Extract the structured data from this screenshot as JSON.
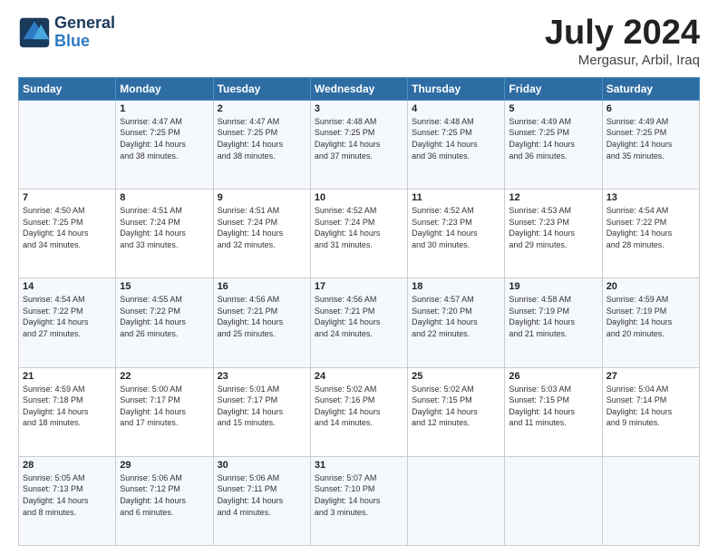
{
  "header": {
    "logo_line1": "General",
    "logo_line2": "Blue",
    "title": "July 2024",
    "subtitle": "Mergasur, Arbil, Iraq"
  },
  "weekdays": [
    "Sunday",
    "Monday",
    "Tuesday",
    "Wednesday",
    "Thursday",
    "Friday",
    "Saturday"
  ],
  "weeks": [
    [
      {
        "day": "",
        "info": ""
      },
      {
        "day": "1",
        "info": "Sunrise: 4:47 AM\nSunset: 7:25 PM\nDaylight: 14 hours\nand 38 minutes."
      },
      {
        "day": "2",
        "info": "Sunrise: 4:47 AM\nSunset: 7:25 PM\nDaylight: 14 hours\nand 38 minutes."
      },
      {
        "day": "3",
        "info": "Sunrise: 4:48 AM\nSunset: 7:25 PM\nDaylight: 14 hours\nand 37 minutes."
      },
      {
        "day": "4",
        "info": "Sunrise: 4:48 AM\nSunset: 7:25 PM\nDaylight: 14 hours\nand 36 minutes."
      },
      {
        "day": "5",
        "info": "Sunrise: 4:49 AM\nSunset: 7:25 PM\nDaylight: 14 hours\nand 36 minutes."
      },
      {
        "day": "6",
        "info": "Sunrise: 4:49 AM\nSunset: 7:25 PM\nDaylight: 14 hours\nand 35 minutes."
      }
    ],
    [
      {
        "day": "7",
        "info": "Sunrise: 4:50 AM\nSunset: 7:25 PM\nDaylight: 14 hours\nand 34 minutes."
      },
      {
        "day": "8",
        "info": "Sunrise: 4:51 AM\nSunset: 7:24 PM\nDaylight: 14 hours\nand 33 minutes."
      },
      {
        "day": "9",
        "info": "Sunrise: 4:51 AM\nSunset: 7:24 PM\nDaylight: 14 hours\nand 32 minutes."
      },
      {
        "day": "10",
        "info": "Sunrise: 4:52 AM\nSunset: 7:24 PM\nDaylight: 14 hours\nand 31 minutes."
      },
      {
        "day": "11",
        "info": "Sunrise: 4:52 AM\nSunset: 7:23 PM\nDaylight: 14 hours\nand 30 minutes."
      },
      {
        "day": "12",
        "info": "Sunrise: 4:53 AM\nSunset: 7:23 PM\nDaylight: 14 hours\nand 29 minutes."
      },
      {
        "day": "13",
        "info": "Sunrise: 4:54 AM\nSunset: 7:22 PM\nDaylight: 14 hours\nand 28 minutes."
      }
    ],
    [
      {
        "day": "14",
        "info": "Sunrise: 4:54 AM\nSunset: 7:22 PM\nDaylight: 14 hours\nand 27 minutes."
      },
      {
        "day": "15",
        "info": "Sunrise: 4:55 AM\nSunset: 7:22 PM\nDaylight: 14 hours\nand 26 minutes."
      },
      {
        "day": "16",
        "info": "Sunrise: 4:56 AM\nSunset: 7:21 PM\nDaylight: 14 hours\nand 25 minutes."
      },
      {
        "day": "17",
        "info": "Sunrise: 4:56 AM\nSunset: 7:21 PM\nDaylight: 14 hours\nand 24 minutes."
      },
      {
        "day": "18",
        "info": "Sunrise: 4:57 AM\nSunset: 7:20 PM\nDaylight: 14 hours\nand 22 minutes."
      },
      {
        "day": "19",
        "info": "Sunrise: 4:58 AM\nSunset: 7:19 PM\nDaylight: 14 hours\nand 21 minutes."
      },
      {
        "day": "20",
        "info": "Sunrise: 4:59 AM\nSunset: 7:19 PM\nDaylight: 14 hours\nand 20 minutes."
      }
    ],
    [
      {
        "day": "21",
        "info": "Sunrise: 4:59 AM\nSunset: 7:18 PM\nDaylight: 14 hours\nand 18 minutes."
      },
      {
        "day": "22",
        "info": "Sunrise: 5:00 AM\nSunset: 7:17 PM\nDaylight: 14 hours\nand 17 minutes."
      },
      {
        "day": "23",
        "info": "Sunrise: 5:01 AM\nSunset: 7:17 PM\nDaylight: 14 hours\nand 15 minutes."
      },
      {
        "day": "24",
        "info": "Sunrise: 5:02 AM\nSunset: 7:16 PM\nDaylight: 14 hours\nand 14 minutes."
      },
      {
        "day": "25",
        "info": "Sunrise: 5:02 AM\nSunset: 7:15 PM\nDaylight: 14 hours\nand 12 minutes."
      },
      {
        "day": "26",
        "info": "Sunrise: 5:03 AM\nSunset: 7:15 PM\nDaylight: 14 hours\nand 11 minutes."
      },
      {
        "day": "27",
        "info": "Sunrise: 5:04 AM\nSunset: 7:14 PM\nDaylight: 14 hours\nand 9 minutes."
      }
    ],
    [
      {
        "day": "28",
        "info": "Sunrise: 5:05 AM\nSunset: 7:13 PM\nDaylight: 14 hours\nand 8 minutes."
      },
      {
        "day": "29",
        "info": "Sunrise: 5:06 AM\nSunset: 7:12 PM\nDaylight: 14 hours\nand 6 minutes."
      },
      {
        "day": "30",
        "info": "Sunrise: 5:06 AM\nSunset: 7:11 PM\nDaylight: 14 hours\nand 4 minutes."
      },
      {
        "day": "31",
        "info": "Sunrise: 5:07 AM\nSunset: 7:10 PM\nDaylight: 14 hours\nand 3 minutes."
      },
      {
        "day": "",
        "info": ""
      },
      {
        "day": "",
        "info": ""
      },
      {
        "day": "",
        "info": ""
      }
    ]
  ]
}
